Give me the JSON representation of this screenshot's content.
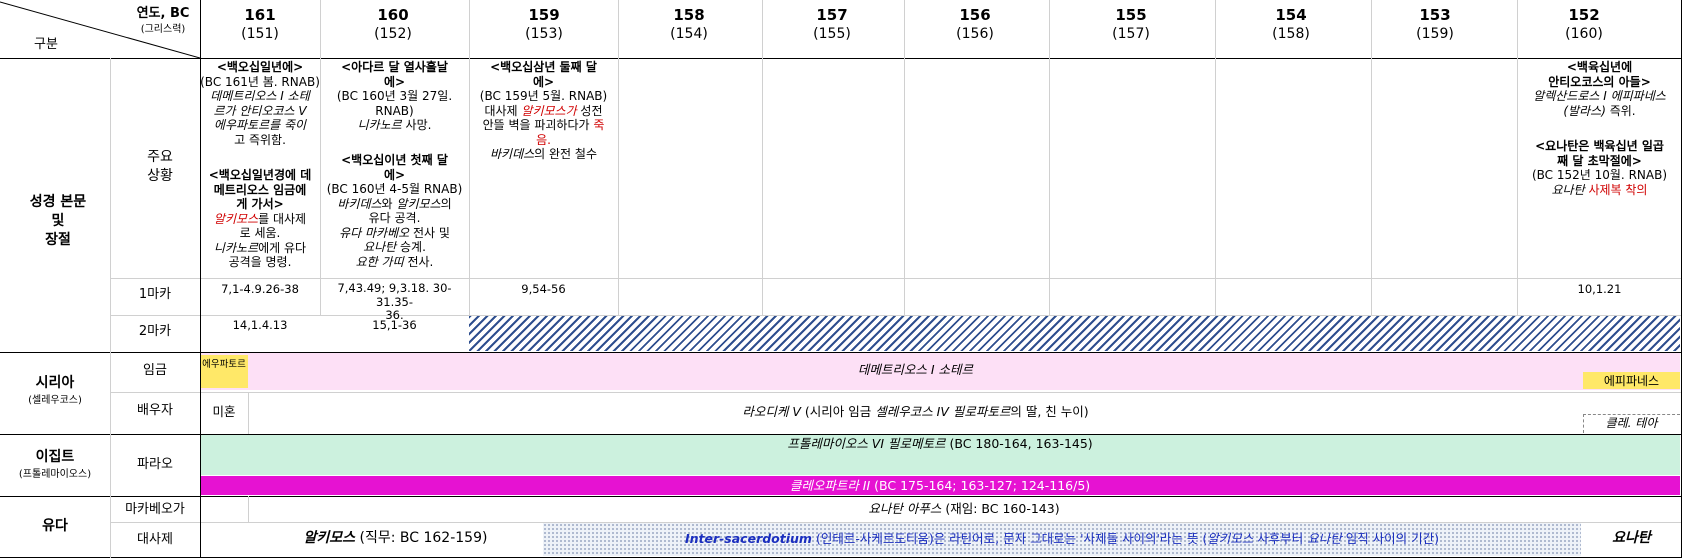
{
  "header": {
    "category": "구분",
    "year_label": "연도, BC",
    "year_sub": "(그리스력)"
  },
  "years": [
    {
      "bc": "161",
      "gk": "(151)"
    },
    {
      "bc": "160",
      "gk": "(152)"
    },
    {
      "bc": "159",
      "gk": "(153)"
    },
    {
      "bc": "158",
      "gk": "(154)"
    },
    {
      "bc": "157",
      "gk": "(155)"
    },
    {
      "bc": "156",
      "gk": "(156)"
    },
    {
      "bc": "155",
      "gk": "(157)"
    },
    {
      "bc": "154",
      "gk": "(158)"
    },
    {
      "bc": "153",
      "gk": "(159)"
    },
    {
      "bc": "152",
      "gk": "(160)"
    }
  ],
  "sections": {
    "bible": "성경 본문\n및\n장절",
    "main": "주요\n상황",
    "mac1": "1마카",
    "mac2": "2마카",
    "syria": "시리아",
    "syria_sub": "(셀레우코스)",
    "king": "임금",
    "spouse": "배우자",
    "egypt": "이집트",
    "egypt_sub": "(프톨레마이오스)",
    "pharaoh": "파라오",
    "judah": "유다",
    "maccabee": "마카베오가",
    "priest": "대사제"
  },
  "events": {
    "y161a_title": "<백오십일년에>",
    "y161a_l1": "(BC 161년 봄. RNAB)",
    "y161a_l2": "데메트리오스 I 소테",
    "y161a_l3": "르가 안티오코스 V",
    "y161a_l4": "에우파토르를 죽이",
    "y161a_l5": "고 즉위함.",
    "y161b_title1": "<백오십일년경에 데",
    "y161b_title2": "메트리오스 임금에",
    "y161b_title3": "게 가서>",
    "y161b_l1a": "알키모스",
    "y161b_l1b": "를 대사제",
    "y161b_l2": "로 세움.",
    "y161b_l3a": "니카노르",
    "y161b_l3b": "에게 유다",
    "y161b_l4": "공격을 명령.",
    "y160a_title1": "<아다르 달 열사흘날",
    "y160a_title2": "에>",
    "y160a_l1": "(BC 160년 3월 27일.",
    "y160a_l2": "RNAB)",
    "y160a_l3a": "니카노르",
    "y160a_l3b": " 사망.",
    "y160b_title1": "<백오십이년 첫째 달",
    "y160b_title2": "에>",
    "y160b_l1": "(BC 160년 4-5월 RNAB)",
    "y160b_l2a": "바키데스",
    "y160b_l2b": "와 ",
    "y160b_l2c": "알키모스",
    "y160b_l2d": "의",
    "y160b_l3": "유다 공격.",
    "y160b_l4a": "유다 마카베오",
    "y160b_l4b": " 전사 및",
    "y160b_l5a": "요나탄",
    "y160b_l5b": " 승계.",
    "y160b_l6a": "요한 가띠",
    "y160b_l6b": " 전사.",
    "y159_title1": "<백오십삼년 둘째 달",
    "y159_title2": "에>",
    "y159_l1": "(BC 159년 5월. RNAB)",
    "y159_l2a": "대사제 ",
    "y159_l2b": "알키모스가",
    "y159_l2c": " 성전",
    "y159_l3a": "안뜰 벽을 파괴하다가 ",
    "y159_l3b": "죽",
    "y159_l4": "음.",
    "y159_l5a": "바키데스",
    "y159_l5b": "의 완전 철수",
    "y152a_title1": "<백육십년에",
    "y152a_title2": "안티오코스의 아들>",
    "y152a_l1": "알렉산드로스  I 에피파네스",
    "y152a_l2a": "(발라스)",
    "y152a_l2b": " 즉위.",
    "y152b_title1": "<요나탄은 백육십년 일곱",
    "y152b_title2": "째 달 초막절에>",
    "y152b_l1": "(BC 152년 10월. RNAB)",
    "y152b_l2a": "요나탄 ",
    "y152b_l2b": "사제복 착의"
  },
  "refs": {
    "m1_161": "7,1-4.9.26-38",
    "m1_160a": "7,43.49; 9,3.18. 30-31.35-",
    "m1_160b": "36.",
    "m1_159": "9,54-56",
    "m1_152": "10,1.21",
    "m2_161": "14,1.4.13",
    "m2_160": "15,1-36"
  },
  "rows": {
    "king_eupator": "에우파토르",
    "king_demetrius": "데메트리오스 I 소테르",
    "king_epiphanes": "에피파네스",
    "spouse_single": "미혼",
    "spouse_laodike_a": "라오디케 V",
    "spouse_laodike_b": " (시리아 임금 ",
    "spouse_laodike_c": "셀레우코스 IV 필로파토르",
    "spouse_laodike_d": "의 딸, 친 누이)",
    "spouse_cleo": "클레. 테아",
    "pharaoh_ptol_a": "프톨레마이오스 VI 필로메토르",
    "pharaoh_ptol_b": " (BC 180-164, 163-145)",
    "pharaoh_cleo_a": "클레오파트라 II",
    "pharaoh_cleo_b": " (BC 175-164; 163-127; 124-116/5)",
    "maccabee_a": "요나탄 아푸스",
    "maccabee_b": " (재임: BC 160-143)",
    "priest_alkimos_a": "알키모스",
    "priest_alkimos_b": " (직무: BC 162-159)",
    "priest_inter_a": "Inter-sacerdotium",
    "priest_inter_b": " (인테르-사케르도티움)은 라틴어로, 문자 그대로는 '사제들 사이의'라는 뜻 (",
    "priest_inter_c": "알키모스",
    "priest_inter_d": " 사후부터 ",
    "priest_inter_e": "요나탄",
    "priest_inter_f": " 임직 사이의 기간)",
    "priest_jonathan": "요나탄"
  },
  "colors": {
    "king_bar": "#fde0f6",
    "yellow": "#ffe868",
    "pharaoh_green": "#ccf1de",
    "pharaoh_magenta": "#e612d2",
    "red": "#d00000",
    "blue": "#1a2ebf"
  }
}
